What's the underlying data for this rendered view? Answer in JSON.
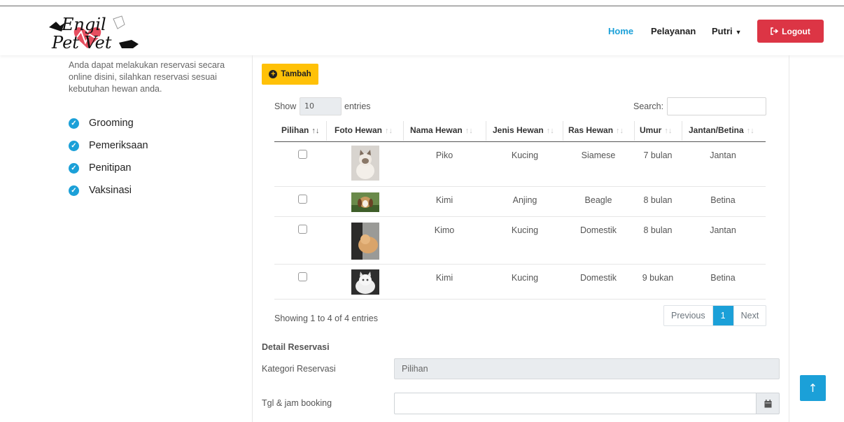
{
  "navbar": {
    "logo_text_line1": "Engil",
    "logo_text_line2": "Pet Vet",
    "home": "Home",
    "pelayanan": "Pelayanan",
    "user": "Putri",
    "logout": "Logout",
    "accent": "#1ba0d8",
    "logout_color": "#dc3545"
  },
  "sidebar": {
    "description": "Anda dapat melakukan reservasi secara online disini, silahkan reservasi sesuai kebutuhan hewan anda.",
    "services": [
      "Grooming",
      "Pemeriksaan",
      "Penitipan",
      "Vaksinasi"
    ]
  },
  "toolbar": {
    "add_label": "Tambah",
    "show_label": "Show",
    "page_length": "10",
    "entries_label": "entries",
    "search_label": "Search:",
    "search_value": ""
  },
  "table": {
    "headers": [
      "Pilihan",
      "Foto Hewan",
      "Nama Hewan",
      "Jenis Hewan",
      "Ras Hewan",
      "Umur",
      "Jantan/Betina"
    ],
    "rows": [
      {
        "nama": "Piko",
        "jenis": "Kucing",
        "ras": "Siamese",
        "umur": "7 bulan",
        "jk": "Jantan",
        "photo": "siamese-cat-photo"
      },
      {
        "nama": "Kimi",
        "jenis": "Anjing",
        "ras": "Beagle",
        "umur": "8 bulan",
        "jk": "Betina",
        "photo": "beagle-dog-photo"
      },
      {
        "nama": "Kimo",
        "jenis": "Kucing",
        "ras": "Domestik",
        "umur": "8 bulan",
        "jk": "Jantan",
        "photo": "orange-cat-photo"
      },
      {
        "nama": "Kimi",
        "jenis": "Kucing",
        "ras": "Domestik",
        "umur": "9 bukan",
        "jk": "Betina",
        "photo": "white-cat-photo"
      }
    ]
  },
  "pagination": {
    "info": "Showing 1 to 4 of 4 entries",
    "previous": "Previous",
    "current": "1",
    "next": "Next"
  },
  "detail": {
    "title": "Detail Reservasi",
    "kategori_label": "Kategori Reservasi",
    "kategori_value": "Pilihan",
    "tgl_label": "Tgl & jam booking",
    "tgl_value": ""
  }
}
